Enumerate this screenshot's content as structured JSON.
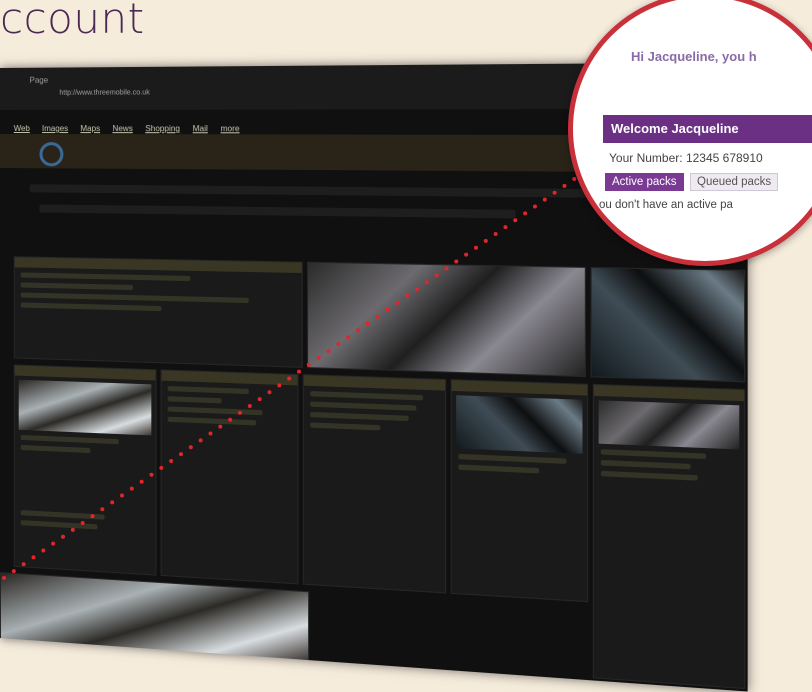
{
  "heading": "ccount",
  "browser": {
    "window_title": "Page",
    "url": "http://www.threemobile.co.uk",
    "menu": [
      "Web",
      "Images",
      "Maps",
      "News",
      "Shopping",
      "Mail",
      "more"
    ]
  },
  "magnifier": {
    "greeting": "Hi Jacqueline, you h",
    "welcome_label": "Welcome Jacqueline",
    "number_label": "Your Number:",
    "number_value": "12345 678910",
    "tabs": [
      {
        "label": "Active packs",
        "active": true
      },
      {
        "label": "Queued packs",
        "active": false
      }
    ],
    "empty_message": "ou don't have an active pa"
  },
  "colors": {
    "accent_purple": "#6b2f84",
    "magnifier_ring": "#c9303a",
    "dotted_line": "#e2252b",
    "background": "#f6ecdc"
  }
}
